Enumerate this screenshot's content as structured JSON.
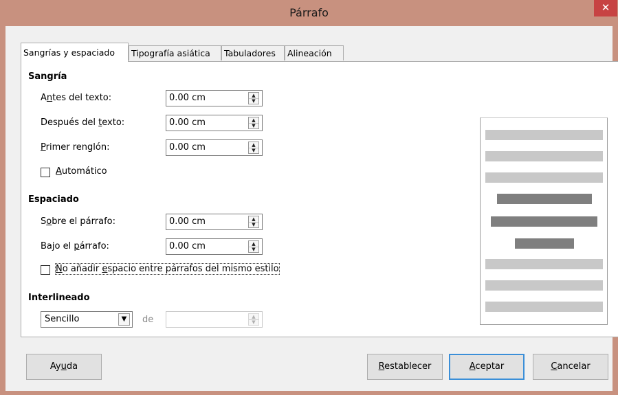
{
  "window": {
    "title": "Párrafo",
    "close_glyph": "✕",
    "titlebar_color": "#c8917f",
    "close_color": "#c74343"
  },
  "tabs": [
    {
      "label": "Sangrías y espaciado",
      "active": true
    },
    {
      "label": "Tipografía asiática",
      "active": false
    },
    {
      "label": "Tabuladores",
      "active": false
    },
    {
      "label": "Alineación",
      "active": false
    }
  ],
  "indent": {
    "section_title": "Sangría",
    "before_label_pre": "A",
    "before_label_acc": "n",
    "before_label_post": "tes del texto:",
    "before_value": "0.00 cm",
    "after_label_pre": "Después del ",
    "after_label_acc": "t",
    "after_label_post": "exto:",
    "after_value": "0.00 cm",
    "first_label_pre": "",
    "first_label_acc": "P",
    "first_label_post": "rimer renglón:",
    "first_value": "0.00 cm",
    "auto_label_acc": "A",
    "auto_label_post": "utomático",
    "auto_checked": false
  },
  "spacing": {
    "section_title": "Espaciado",
    "above_label_pre": "S",
    "above_label_acc": "o",
    "above_label_post": "bre el párrafo:",
    "above_value": "0.00 cm",
    "below_label_pre": "Bajo el ",
    "below_label_acc": "p",
    "below_label_post": "árrafo:",
    "below_value": "0.00 cm",
    "noadd_label_acc": "N",
    "noadd_label_mid1": "o añadir ",
    "noadd_label_acc2": "e",
    "noadd_label_post": "spacio entre párrafos del mismo estilo",
    "noadd_checked": false
  },
  "line_spacing": {
    "section_title": "Interlineado",
    "selected": "Sencillo",
    "of_label": "de",
    "of_value": ""
  },
  "buttons": {
    "help_pre": "Ay",
    "help_acc": "u",
    "help_post": "da",
    "reset_acc": "R",
    "reset_post": "establecer",
    "ok_acc": "A",
    "ok_post": "ceptar",
    "cancel_acc": "C",
    "cancel_post": "ancelar"
  },
  "preview_colors": {
    "light": "#c8c8c8",
    "dark": "#7f7f7f"
  }
}
